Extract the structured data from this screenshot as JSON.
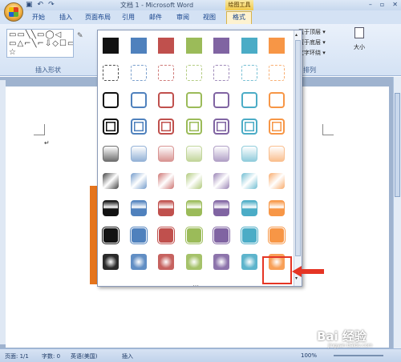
{
  "app": {
    "title": "文档 1 - Microsoft Word",
    "context_tab": "绘图工具",
    "quick_access": [
      "▣",
      "↶",
      "↷"
    ]
  },
  "tabs": [
    "开始",
    "插入",
    "页面布局",
    "引用",
    "邮件",
    "审阅",
    "视图",
    "格式"
  ],
  "ribbon": {
    "insert_shapes_label": "插入形状",
    "shape_glyphs": "▭▭╲╲▭◯◁ ▭△⌐╲⌐⇩◇☐▭╲╲⌒⌐{}☆",
    "edit_icon": "✎",
    "arrange_items": [
      "置于顶层 ▾",
      "置于底层 ▾",
      "文字环绕 ▾"
    ],
    "arrange_group_label": "排列",
    "size_label": "大小"
  },
  "status": {
    "page": "页面: 1/1",
    "words": "字数: 0",
    "language": "英语(美国)",
    "mode": "插入",
    "zoom": "100%"
  },
  "watermark": {
    "brand": "Bai 经验",
    "url": "jingyan.baidu.com"
  },
  "style_gallery": {
    "colors": [
      "#121212",
      "#4f81bd",
      "#c0504d",
      "#9bbb59",
      "#8064a2",
      "#4bacc6",
      "#f79646"
    ],
    "row_styles": [
      "solid",
      "dashed-outline",
      "outline",
      "double-outline",
      "gradient-light",
      "gradient-diagonal",
      "gradient-dark",
      "framed-solid",
      "bevel-glow"
    ],
    "selected": {
      "row": 8,
      "col": 6
    }
  },
  "icons": {
    "office_button": "office-logo-icon",
    "scroll_down": "▾",
    "grip": "⋯"
  }
}
